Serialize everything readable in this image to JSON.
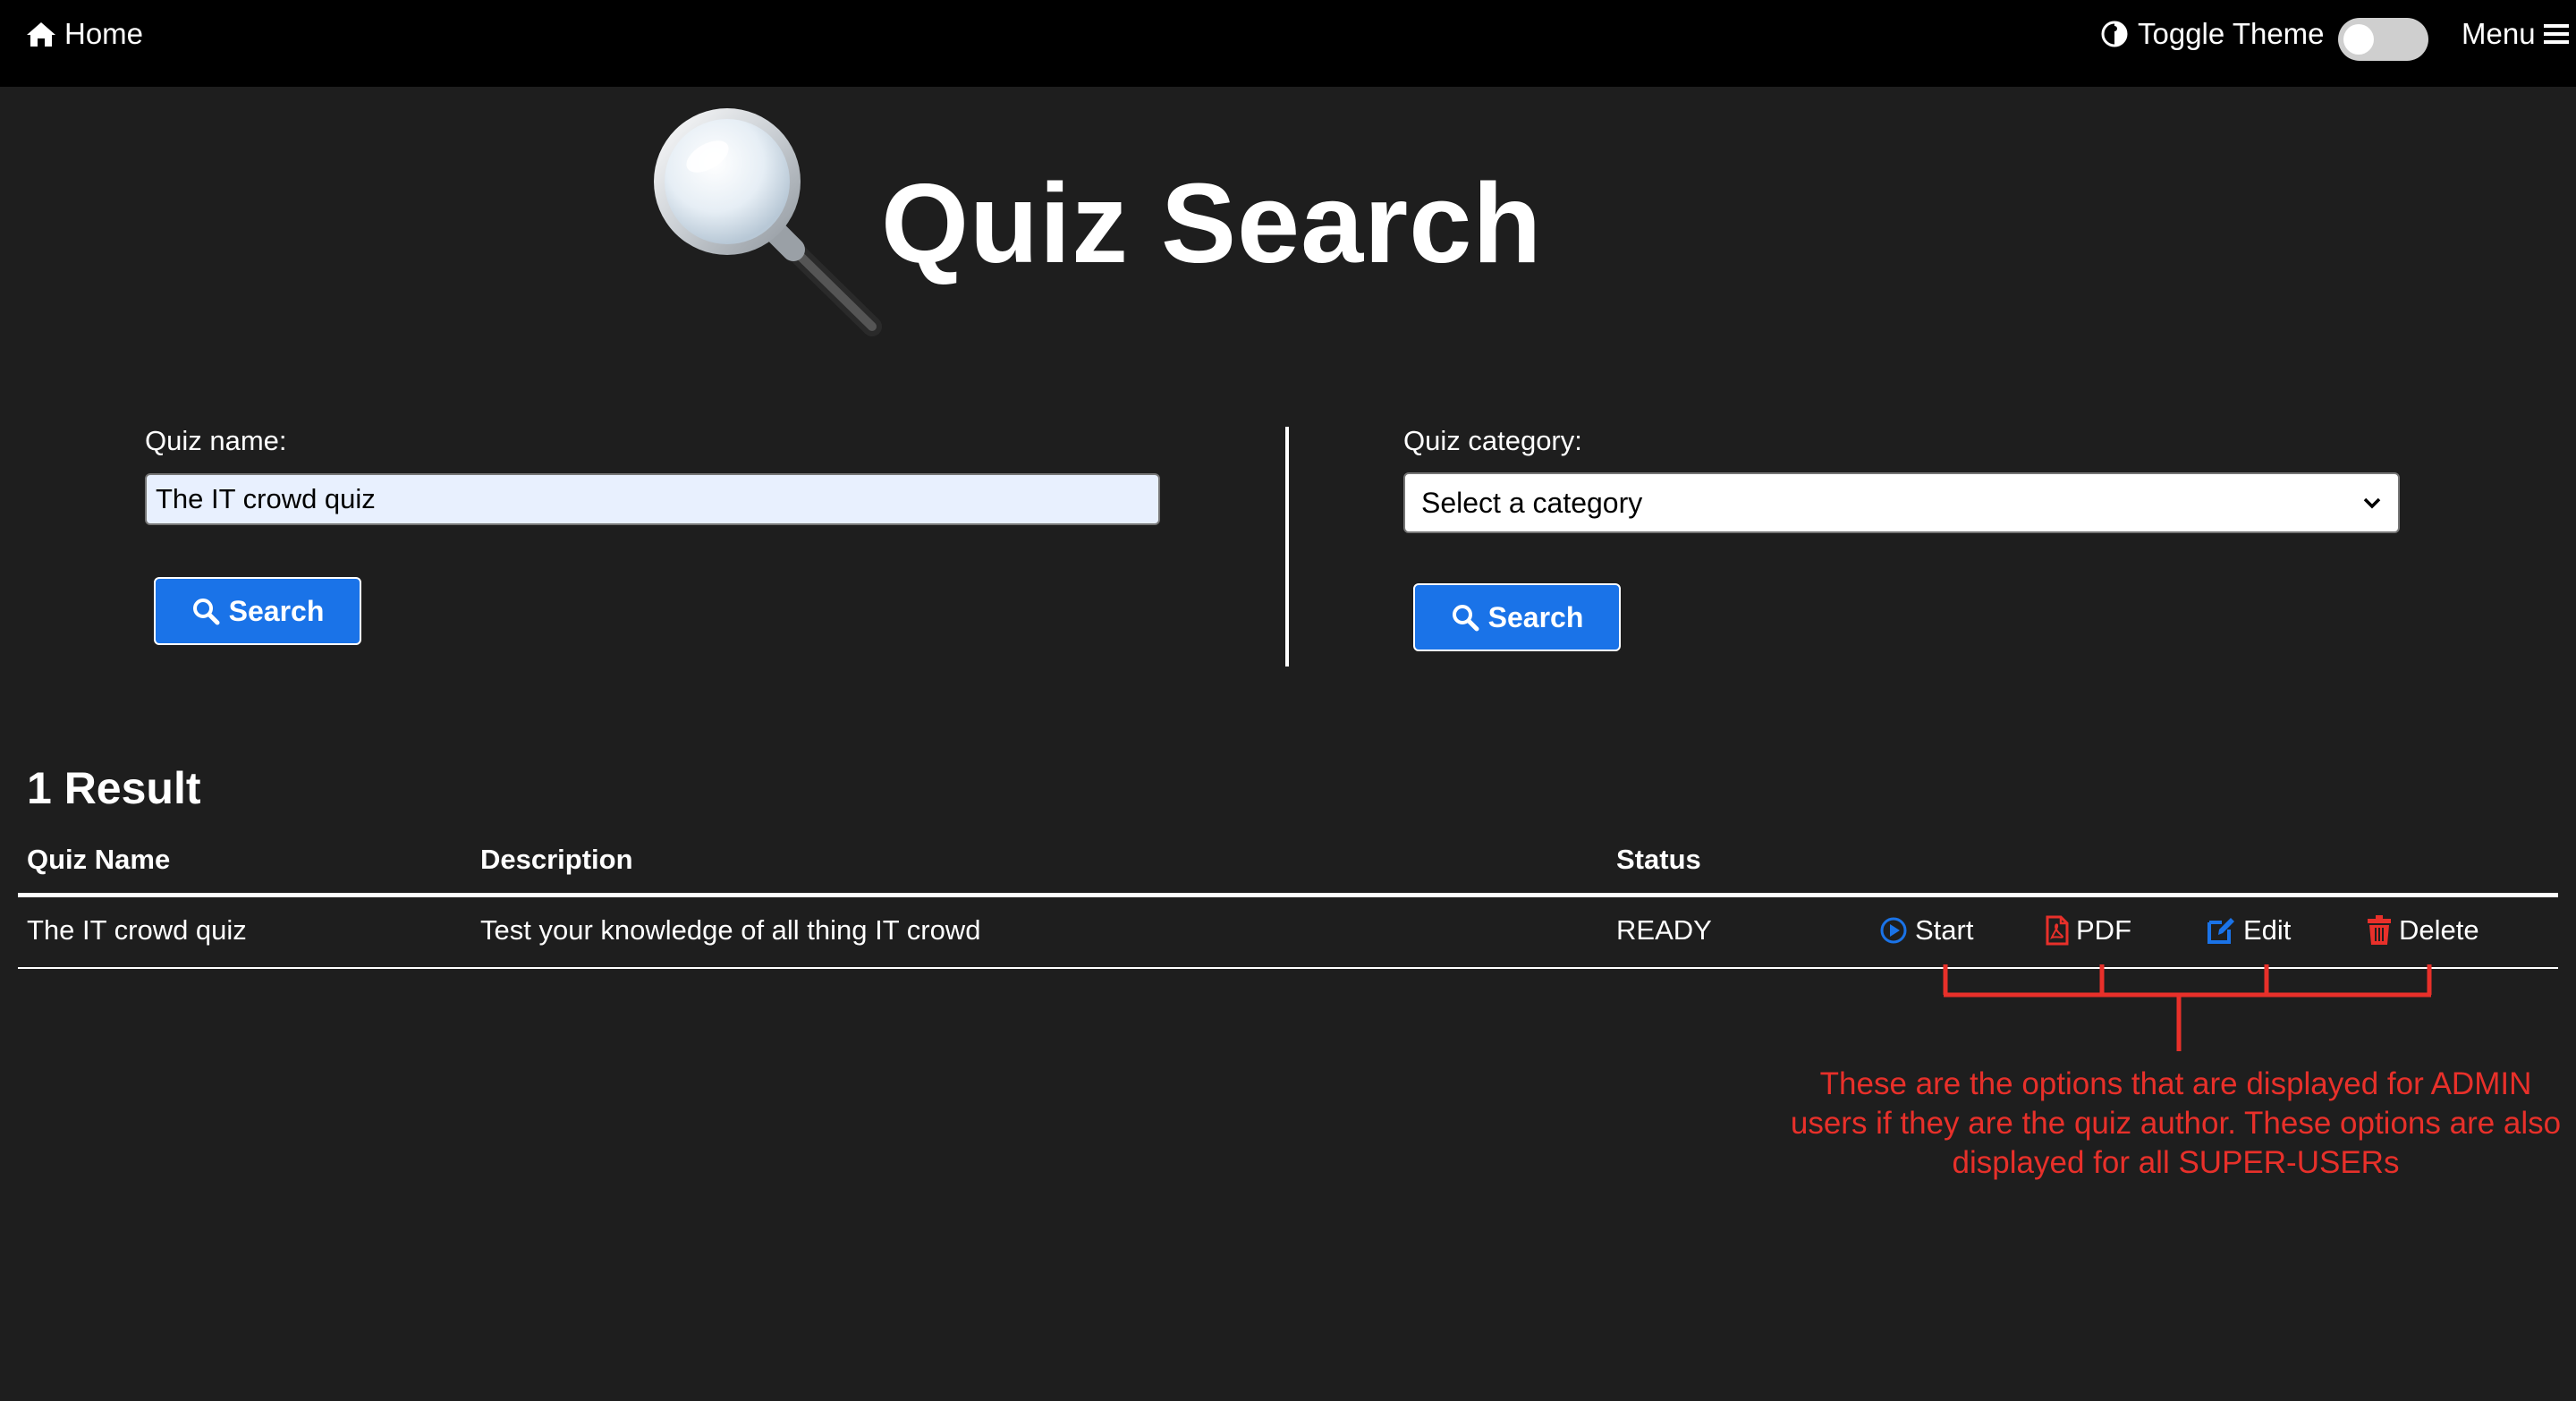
{
  "topbar": {
    "home_label": "Home",
    "toggle_theme_label": "Toggle Theme",
    "menu_label": "Menu"
  },
  "page": {
    "title": "Quiz Search"
  },
  "search_by_name": {
    "label": "Quiz name:",
    "value": "The IT crowd quiz",
    "button_label": "Search"
  },
  "search_by_category": {
    "label": "Quiz category:",
    "selected": "Select a category",
    "button_label": "Search"
  },
  "results": {
    "heading": "1 Result",
    "columns": [
      "Quiz Name",
      "Description",
      "Status"
    ],
    "rows": [
      {
        "name": "The IT crowd quiz",
        "description": "Test your knowledge of all thing IT crowd",
        "status": "READY",
        "actions": [
          "Start",
          "PDF",
          "Edit",
          "Delete"
        ]
      }
    ]
  },
  "annotation": {
    "text": "These are the options that are displayed for ADMIN users if they are the quiz author.  These options are also displayed for all SUPER-USERs",
    "color": "#e8302a"
  },
  "colors": {
    "accent": "#1a73e8",
    "topbar": "#000000",
    "background": "#1e1e1e",
    "delete": "#e8302a"
  },
  "icons": [
    "home-icon",
    "theme-icon",
    "hamburger-icon",
    "magnifier-icon",
    "search-icon",
    "play-circle-icon",
    "pdf-icon",
    "edit-icon",
    "trash-icon"
  ]
}
